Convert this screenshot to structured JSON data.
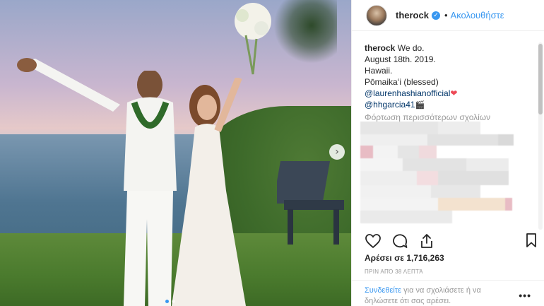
{
  "post": {
    "photo_alt": "wedding-photo",
    "next_glyph": "›",
    "dots_count": 2
  },
  "header": {
    "username": "therock",
    "verified_glyph": "✓",
    "separator": "•",
    "follow_label": "Ακολουθήστε"
  },
  "caption": {
    "username": "therock",
    "line1": "We do.",
    "line2": "August 18th. 2019.",
    "line3": "Hawaii.",
    "line4": "Pōmaikaʻi (blessed)",
    "mention1": "@laurenhashianofficial",
    "heart": "❤",
    "mention2": "@hhgarcia41",
    "clapper": "🎬",
    "load_more": "Φόρτωση περισσότερων σχολίων"
  },
  "actions": {
    "like_icon": "heart-icon",
    "comment_icon": "comment-icon",
    "share_icon": "share-icon",
    "save_icon": "bookmark-icon"
  },
  "likes_text": "Αρέσει σε 1,716,263",
  "timestamp": "ΠΡΙΝ ΑΠΌ 38 ΛΕΠΤΆ",
  "login": {
    "link": "Συνδεθείτε",
    "rest": " για να σχολιάσετε ή να δηλώσετε ότι σας αρέσει."
  },
  "more_label": "•••",
  "colors": {
    "accent": "#3897f0",
    "heart": "#ed4956",
    "mention": "#003569"
  }
}
